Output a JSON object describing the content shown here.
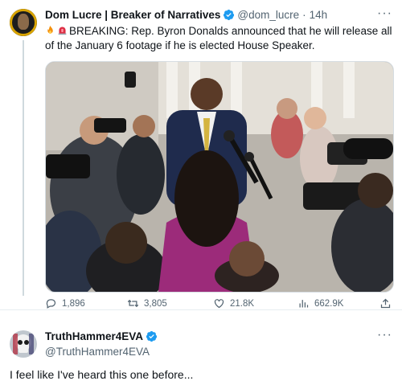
{
  "tweet": {
    "author_name": "Dom Lucre | Breaker of Narratives",
    "handle": "@dom_lucre",
    "separator": "·",
    "time": "14h",
    "more": "···",
    "emoji_1": "fire-emoji",
    "emoji_2": "siren-emoji",
    "text": "BREAKING: Rep. Byron Donalds announced that he will release all of the January 6 footage if he is elected House Speaker.",
    "media_description_icon": "photo",
    "stats": {
      "replies": "1,896",
      "retweets": "3,805",
      "likes": "21.8K",
      "views": "662.9K"
    }
  },
  "reply": {
    "author_name": "TruthHammer4EVA",
    "handle": "@TruthHammer4EVA",
    "more": "···",
    "text": "I feel like I've heard this one before..."
  },
  "colors": {
    "verified": "#1d9bf0",
    "secondary_text": "#536471",
    "primary_text": "#0f1419",
    "divider": "#e6ecf0"
  },
  "icons": {
    "reply": "reply-icon",
    "retweet": "retweet-icon",
    "like": "heart-icon",
    "views": "views-chart-icon",
    "share": "share-icon",
    "verified": "verified-badge-icon"
  }
}
